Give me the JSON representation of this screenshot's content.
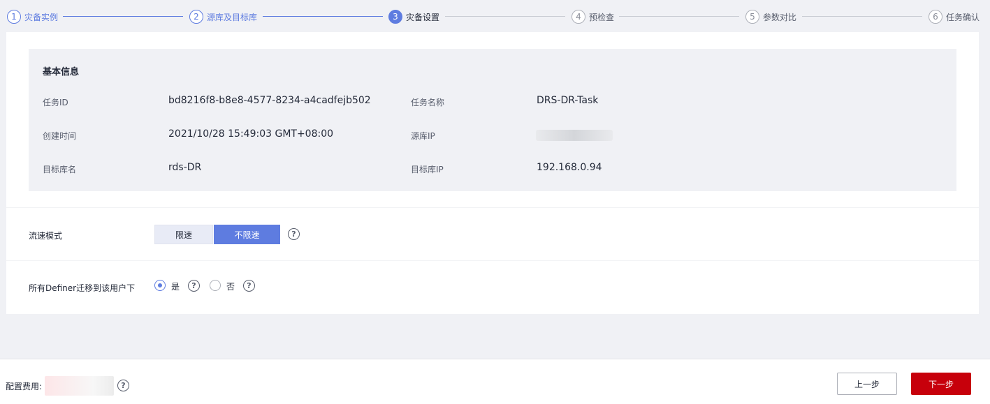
{
  "steps": [
    {
      "num": "1",
      "label": "灾备实例",
      "state": "done"
    },
    {
      "num": "2",
      "label": "源库及目标库",
      "state": "done"
    },
    {
      "num": "3",
      "label": "灾备设置",
      "state": "active"
    },
    {
      "num": "4",
      "label": "预检查",
      "state": "todo"
    },
    {
      "num": "5",
      "label": "参数对比",
      "state": "todo"
    },
    {
      "num": "6",
      "label": "任务确认",
      "state": "todo"
    }
  ],
  "basic_info": {
    "title": "基本信息",
    "task_id_label": "任务ID",
    "task_id": "bd8216f8-b8e8-4577-8234-a4cadfejb502",
    "task_name_label": "任务名称",
    "task_name": "DRS-DR-Task",
    "created_label": "创建时间",
    "created": "2021/10/28 15:49:03 GMT+08:00",
    "source_ip_label": "源库IP",
    "target_db_label": "目标库名",
    "target_db": "rds-DR",
    "target_ip_label": "目标库IP",
    "target_ip": "192.168.0.94"
  },
  "flow_mode": {
    "label": "流速模式",
    "option_limited": "限速",
    "option_unlimited": "不限速",
    "selected": "不限速"
  },
  "definer": {
    "label": "所有Definer迁移到该用户下",
    "option_yes": "是",
    "option_no": "否",
    "selected": "是"
  },
  "footer": {
    "fee_label": "配置费用:",
    "prev_label": "上一步",
    "next_label": "下一步"
  },
  "colors": {
    "accent": "#5e7ce0",
    "primary_button": "#c7000b"
  }
}
